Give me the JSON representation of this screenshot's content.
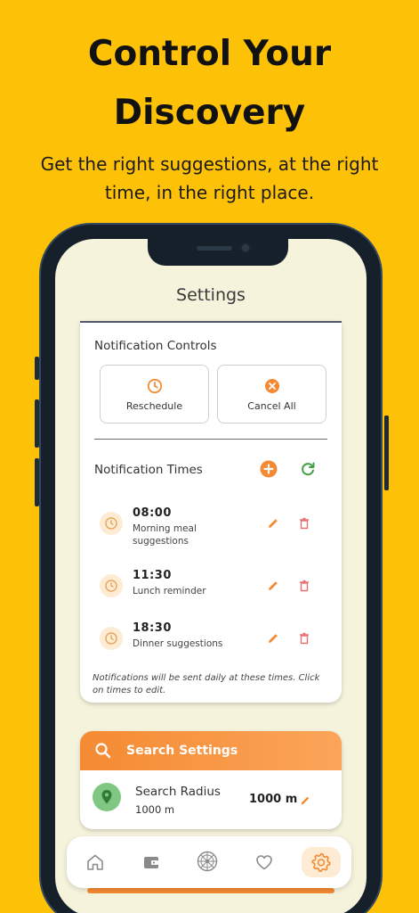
{
  "hero": {
    "title_line1": "Control Your",
    "title_line2": "Discovery",
    "subtitle": "Get the right suggestions, at the right time, in the right place."
  },
  "screen_title": "Settings",
  "notification_controls": {
    "label": "Notification Controls",
    "reschedule_label": "Reschedule",
    "cancel_all_label": "Cancel All"
  },
  "notification_times": {
    "label": "Notification Times",
    "items": [
      {
        "time": "08:00",
        "description": "Morning meal suggestions"
      },
      {
        "time": "11:30",
        "description": "Lunch reminder"
      },
      {
        "time": "18:30",
        "description": "Dinner suggestions"
      }
    ],
    "note": "Notifications will be sent daily at these times. Click on times to edit."
  },
  "search_settings": {
    "label": "Search Settings",
    "radius_label": "Search Radius",
    "radius_sub": "1000 m",
    "radius_value": "1000 m"
  },
  "bottom_nav": {
    "items": [
      {
        "icon": "home-icon",
        "active": false
      },
      {
        "icon": "wallet-icon",
        "active": false
      },
      {
        "icon": "wheel-icon",
        "active": false
      },
      {
        "icon": "heart-icon",
        "active": false
      },
      {
        "icon": "gear-icon",
        "active": true
      }
    ]
  },
  "colors": {
    "background": "#FDC107",
    "accent_orange": "#F58A32",
    "accent_green": "#43A047",
    "delete_red": "#E57373",
    "screen_bg": "#F5F3DC"
  }
}
